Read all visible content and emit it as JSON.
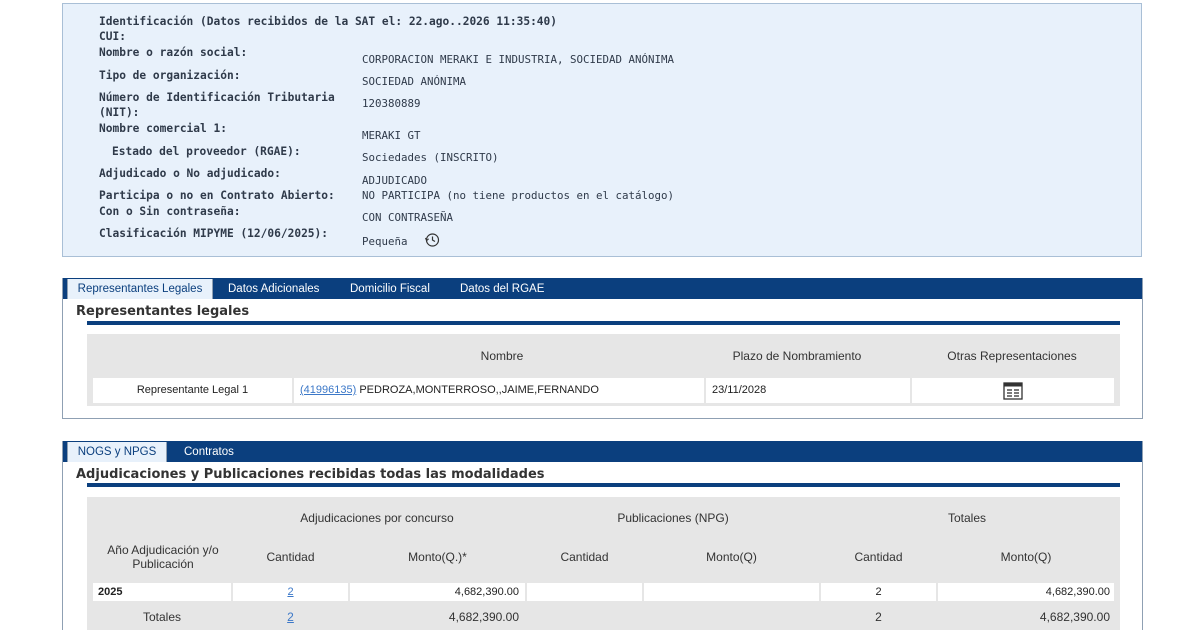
{
  "identification": {
    "header": "Identificación (Datos recibidos de la SAT el: 22.ago..2026 11:35:40)",
    "fields": [
      {
        "label": "CUI:",
        "value": ""
      },
      {
        "label": "Nombre o razón social:",
        "value": "CORPORACION MERAKI E INDUSTRIA, SOCIEDAD ANÓNIMA"
      },
      {
        "label": "Tipo de organización:",
        "value": "SOCIEDAD ANÓNIMA"
      },
      {
        "label": "Número de Identificación Tributaria",
        "label2": "(NIT):",
        "value": "120380889"
      },
      {
        "label": "Nombre comercial 1:",
        "value": "MERAKI GT"
      },
      {
        "label": "Estado del proveedor (RGAE):",
        "value": "Sociedades (INSCRITO)"
      },
      {
        "label": "Adjudicado o No adjudicado:",
        "value": "ADJUDICADO"
      },
      {
        "label": "Participa o no en Contrato Abierto:",
        "value": "NO PARTICIPA (no tiene productos en el catálogo)"
      },
      {
        "label": "Con o Sin contraseña:",
        "value": "CON CONTRASEÑA"
      },
      {
        "label": "Clasificación MIPYME (12/06/2025):",
        "value": "Pequeña"
      }
    ]
  },
  "representantes": {
    "tabs": [
      "Representantes Legales",
      "Datos Adicionales",
      "Domicilio Fiscal",
      "Datos del RGAE"
    ],
    "title": "Representantes legales",
    "columns": [
      "Nombre",
      "Plazo de Nombramiento",
      "Otras Representaciones"
    ],
    "rows": [
      {
        "role": "Representante Legal 1",
        "id": "(41996135)",
        "name": "PEDROZA,MONTERROSO,,JAIME,FERNANDO",
        "plazo": "23/11/2028"
      }
    ]
  },
  "adjudicaciones": {
    "tabs": [
      "NOGS y NPGS",
      "Contratos"
    ],
    "title": "Adjudicaciones y Publicaciones recibidas todas las modalidades",
    "groups": [
      "Adjudicaciones por concurso",
      "Publicaciones (NPG)",
      "Totales"
    ],
    "year_header": "Año Adjudicación y/o Publicación",
    "sub_headers": [
      "Cantidad",
      "Monto(Q.)*",
      "Cantidad",
      "Monto(Q)",
      "Cantidad",
      "Monto(Q)"
    ],
    "rows": [
      {
        "year": "2025",
        "adj_cant": "2",
        "adj_monto": "4,682,390.00",
        "pub_cant": "",
        "pub_monto": "",
        "tot_cant": "2",
        "tot_monto": "4,682,390.00"
      }
    ],
    "totals": {
      "label": "Totales",
      "adj_cant": "2",
      "adj_monto": "4,682,390.00",
      "tot_cant": "2",
      "tot_monto": "4,682,390.00"
    }
  }
}
